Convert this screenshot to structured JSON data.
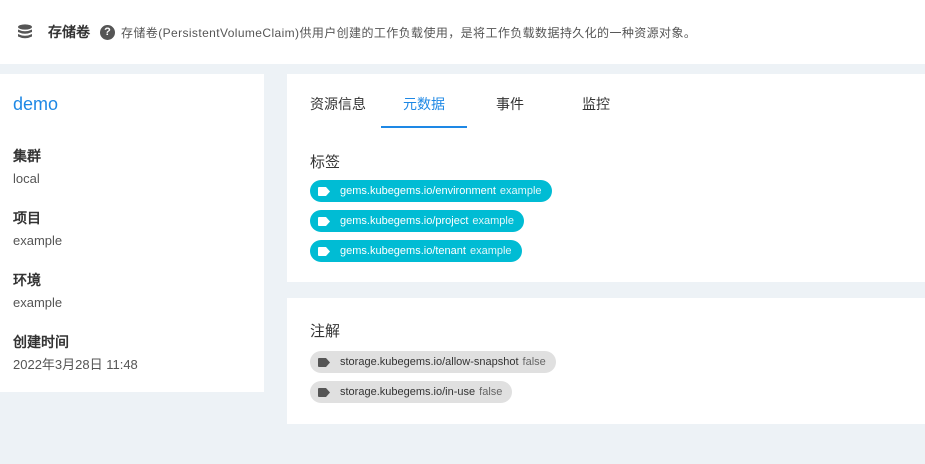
{
  "header": {
    "icon": "database-icon",
    "title": "存储卷",
    "help_icon_glyph": "?",
    "description": "存储卷(PersistentVolumeClaim)供用户创建的工作负载使用，是将工作负载数据持久化的一种资源对象。"
  },
  "sidebar": {
    "name": "demo",
    "fields": [
      {
        "label": "集群",
        "value": "local"
      },
      {
        "label": "项目",
        "value": "example"
      },
      {
        "label": "环境",
        "value": "example"
      },
      {
        "label": "创建时间",
        "value": "2022年3月28日 11:48"
      }
    ]
  },
  "tabs": [
    {
      "label": "资源信息",
      "active": false
    },
    {
      "label": "元数据",
      "active": true
    },
    {
      "label": "事件",
      "active": false
    },
    {
      "label": "监控",
      "active": false
    }
  ],
  "labels_section": {
    "title": "标签",
    "items": [
      {
        "key": "gems.kubegems.io/environment",
        "value": "example"
      },
      {
        "key": "gems.kubegems.io/project",
        "value": "example"
      },
      {
        "key": "gems.kubegems.io/tenant",
        "value": "example"
      }
    ]
  },
  "annotations_section": {
    "title": "注解",
    "items": [
      {
        "key": "storage.kubegems.io/allow-snapshot",
        "value": "false"
      },
      {
        "key": "storage.kubegems.io/in-use",
        "value": "false"
      }
    ]
  },
  "colors": {
    "accent": "#1e88e5",
    "label_chip": "#00bcd4",
    "annotation_chip": "#e0e0e0",
    "background": "#edf2f6"
  }
}
